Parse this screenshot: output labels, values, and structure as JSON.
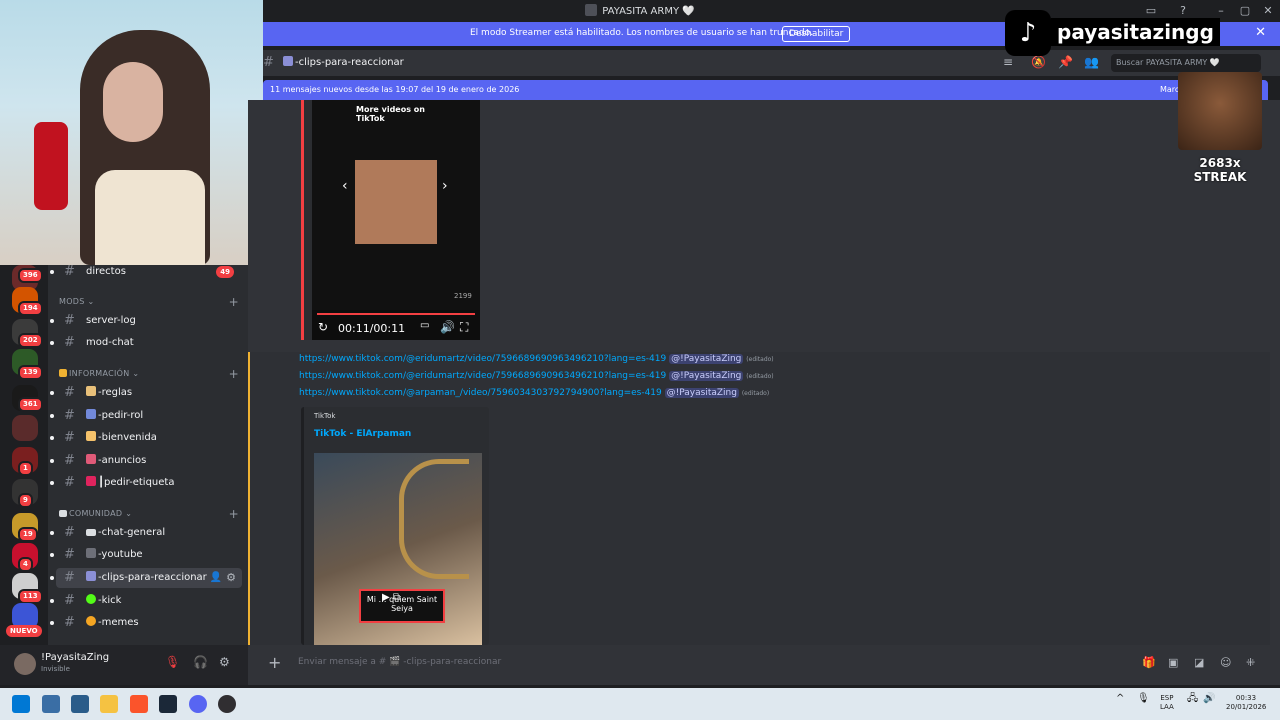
{
  "window": {
    "title": "PAYASITA ARMY 🤍"
  },
  "streamer_banner": {
    "message": "El modo Streamer está habilitado. Los nombres de usuario se han truncado.",
    "button": "Deshabilitar"
  },
  "servers": {
    "badges": [
      "396",
      "194",
      "202",
      "139",
      "361",
      "1",
      "9",
      "19",
      "4",
      "113"
    ],
    "nuevo": "NUEVO"
  },
  "channels": {
    "directos": {
      "label": "directos",
      "badge": "49"
    },
    "categories": {
      "mods": "MODS",
      "informacion": "INFORMACIÓN",
      "comunidad": "COMUNIDAD"
    },
    "items": {
      "server_log": "server-log",
      "mod_chat": "mod-chat",
      "reglas": "-reglas",
      "pedir_rol": "-pedir-rol",
      "bienvenida": "-bienvenida",
      "anuncios": "-anuncios",
      "pedir_etiqueta": "┃pedir-etiqueta",
      "chat_general": "-chat-general",
      "youtube": "-youtube",
      "clips": "-clips-para-reaccionar",
      "kick": "-kick",
      "memes": "-memes"
    }
  },
  "user": {
    "name": "!PayasitaZing",
    "status": "Invisible"
  },
  "header": {
    "channel": "-clips-para-reaccionar",
    "search_placeholder": "Buscar PAYASITA ARMY 🤍"
  },
  "new_messages": {
    "text": "11 mensajes nuevos desde las 19:07 del 19 de enero de 2026",
    "mark": "Marc"
  },
  "video": {
    "more_videos": "More videos on TikTok",
    "count": "2199",
    "time": "00:11/00:11"
  },
  "messages": [
    {
      "url": "https://www.tiktok.com/@eridumartz/video/7596689690963496210?lang=es-419",
      "mention": "@!PayasitaZing",
      "edited": "(editado)"
    },
    {
      "url": "https://www.tiktok.com/@eridumartz/video/7596689690963496210?lang=es-419",
      "mention": "@!PayasitaZing",
      "edited": "(editado)"
    },
    {
      "url": "https://www.tiktok.com/@arpaman_/video/7596034303792794900?lang=es-419",
      "mention": "@!PayasitaZing",
      "edited": "(editado)"
    }
  ],
  "embed": {
    "provider": "TikTok",
    "title": "TikTok - ElArpaman",
    "caption": "Mi … quiem Saint Seiya"
  },
  "composer": {
    "placeholder": "Enviar mensaje a # 🎬 -clips-para-reaccionar"
  },
  "overlay": {
    "handle": "payasitazingg",
    "streak": "2683x STREAK"
  },
  "taskbar": {
    "lang": "ESP",
    "lang2": "LAA",
    "time": "00:33",
    "date": "20/01/2026"
  },
  "colors": {
    "accent": "#5865f2",
    "danger": "#f23f42",
    "link": "#00a8fc",
    "highlight": "#f0b232"
  }
}
